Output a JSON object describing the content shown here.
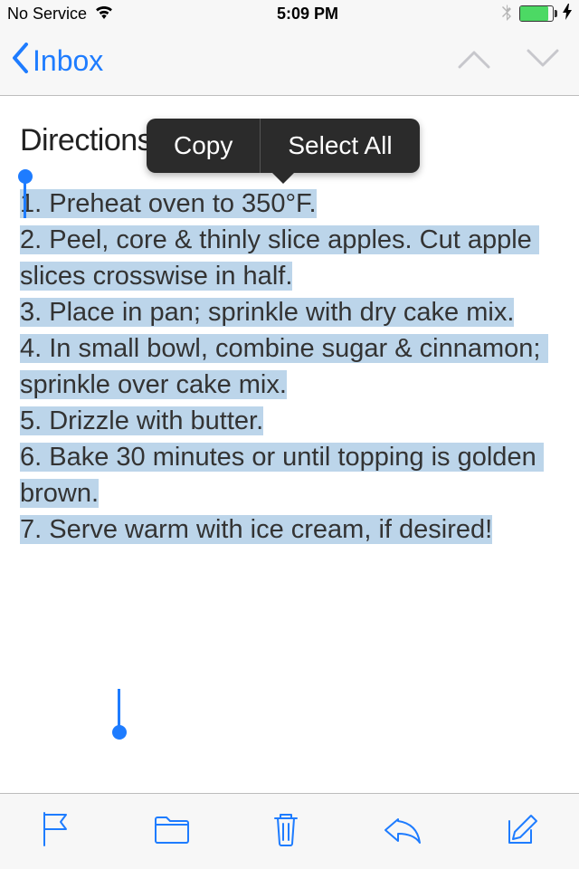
{
  "status": {
    "carrier": "No Service",
    "time": "5:09 PM"
  },
  "nav": {
    "back_label": "Inbox"
  },
  "popover": {
    "copy": "Copy",
    "select_all": "Select All"
  },
  "email": {
    "heading": "Directions",
    "body": "1. Preheat oven to 350°F.\n2. Peel, core & thinly slice apples. Cut apple slices crosswise in half.\n3. Place in pan; sprinkle with dry cake mix.\n4. In small bowl, combine sugar & cinnamon; sprinkle over cake mix.\n5. Drizzle with butter.\n6. Bake 30 minutes or until topping is golden brown.\n7. Serve warm with ice cream, if desired!"
  }
}
